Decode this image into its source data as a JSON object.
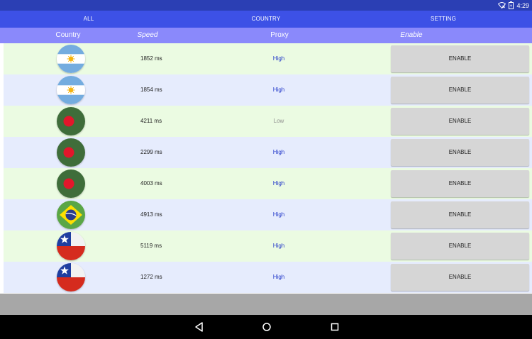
{
  "status_bar": {
    "time": "4:29",
    "icons": [
      "wifi-off-icon",
      "battery-icon"
    ]
  },
  "tabs": [
    {
      "label": "ALL"
    },
    {
      "label": "COUNTRY"
    },
    {
      "label": "SETTING"
    }
  ],
  "columns": {
    "country": "Country",
    "speed": "Speed",
    "proxy": "Proxy",
    "enable": "Enable"
  },
  "rows": [
    {
      "flag": "argentina",
      "speed": "1852  ms",
      "proxy": "High",
      "button": "ENABLE"
    },
    {
      "flag": "argentina",
      "speed": "1854  ms",
      "proxy": "High",
      "button": "ENABLE"
    },
    {
      "flag": "bangladesh",
      "speed": "4211  ms",
      "proxy": "Low",
      "button": "ENABLE"
    },
    {
      "flag": "bangladesh",
      "speed": "2299  ms",
      "proxy": "High",
      "button": "ENABLE"
    },
    {
      "flag": "bangladesh",
      "speed": "4003  ms",
      "proxy": "High",
      "button": "ENABLE"
    },
    {
      "flag": "brazil",
      "speed": "4913  ms",
      "proxy": "High",
      "button": "ENABLE"
    },
    {
      "flag": "chile",
      "speed": "5119  ms",
      "proxy": "High",
      "button": "ENABLE"
    },
    {
      "flag": "chile",
      "speed": "1272  ms",
      "proxy": "High",
      "button": "ENABLE"
    }
  ],
  "navigation": {
    "icons": [
      "back-icon",
      "home-icon",
      "recent-apps-icon"
    ]
  },
  "colors": {
    "status_bar": "#2b3fb4",
    "tab_bar": "#3d51e6",
    "column_header": "#8a89fb",
    "row_green": "#ebfbe2",
    "row_blue": "#e6ecfd",
    "proxy_high": "#2137c9",
    "proxy_low": "#8e8e8e",
    "button": "#d6d6d6"
  }
}
